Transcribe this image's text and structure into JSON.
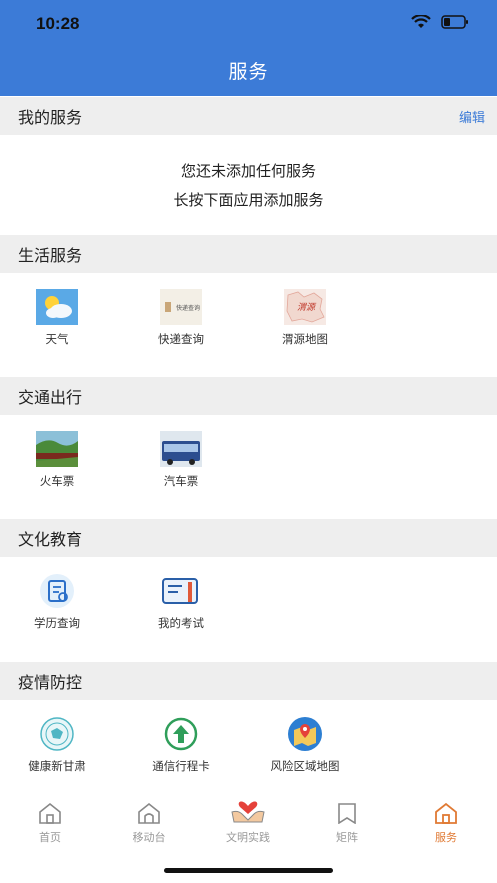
{
  "status": {
    "time": "10:28"
  },
  "nav": {
    "title": "服务"
  },
  "my_service": {
    "title": "我的服务",
    "edit": "编辑",
    "empty_line1": "您还未添加任何服务",
    "empty_line2": "长按下面应用添加服务"
  },
  "sections": [
    {
      "title": "生活服务",
      "items": [
        {
          "label": "天气",
          "icon": "weather-icon"
        },
        {
          "label": "快递查询",
          "icon": "express-query-icon",
          "icon_text": "快递查询"
        },
        {
          "label": "渭源地图",
          "icon": "weiyuan-map-icon",
          "icon_text": "渭源"
        }
      ]
    },
    {
      "title": "交通出行",
      "items": [
        {
          "label": "火车票",
          "icon": "train-ticket-icon"
        },
        {
          "label": "汽车票",
          "icon": "bus-ticket-icon"
        }
      ]
    },
    {
      "title": "文化教育",
      "items": [
        {
          "label": "学历查询",
          "icon": "education-query-icon"
        },
        {
          "label": "我的考试",
          "icon": "my-exam-icon"
        }
      ]
    },
    {
      "title": "疫情防控",
      "items": [
        {
          "label": "健康新甘肃",
          "icon": "health-gansu-icon"
        },
        {
          "label": "通信行程卡",
          "icon": "travel-card-icon"
        },
        {
          "label": "风险区域地图",
          "icon": "risk-map-icon"
        }
      ]
    }
  ],
  "tabbar": [
    {
      "label": "首页",
      "icon": "home-icon",
      "active": false
    },
    {
      "label": "移动台",
      "icon": "mobile-station-icon",
      "active": false
    },
    {
      "label": "文明实践",
      "icon": "civilization-practice-icon",
      "active": false
    },
    {
      "label": "矩阵",
      "icon": "matrix-icon",
      "active": false
    },
    {
      "label": "服务",
      "icon": "service-icon",
      "active": true
    }
  ],
  "colors": {
    "primary": "#3c7bd7",
    "active_tab": "#e07a34",
    "section_bg": "#eeeeee"
  }
}
